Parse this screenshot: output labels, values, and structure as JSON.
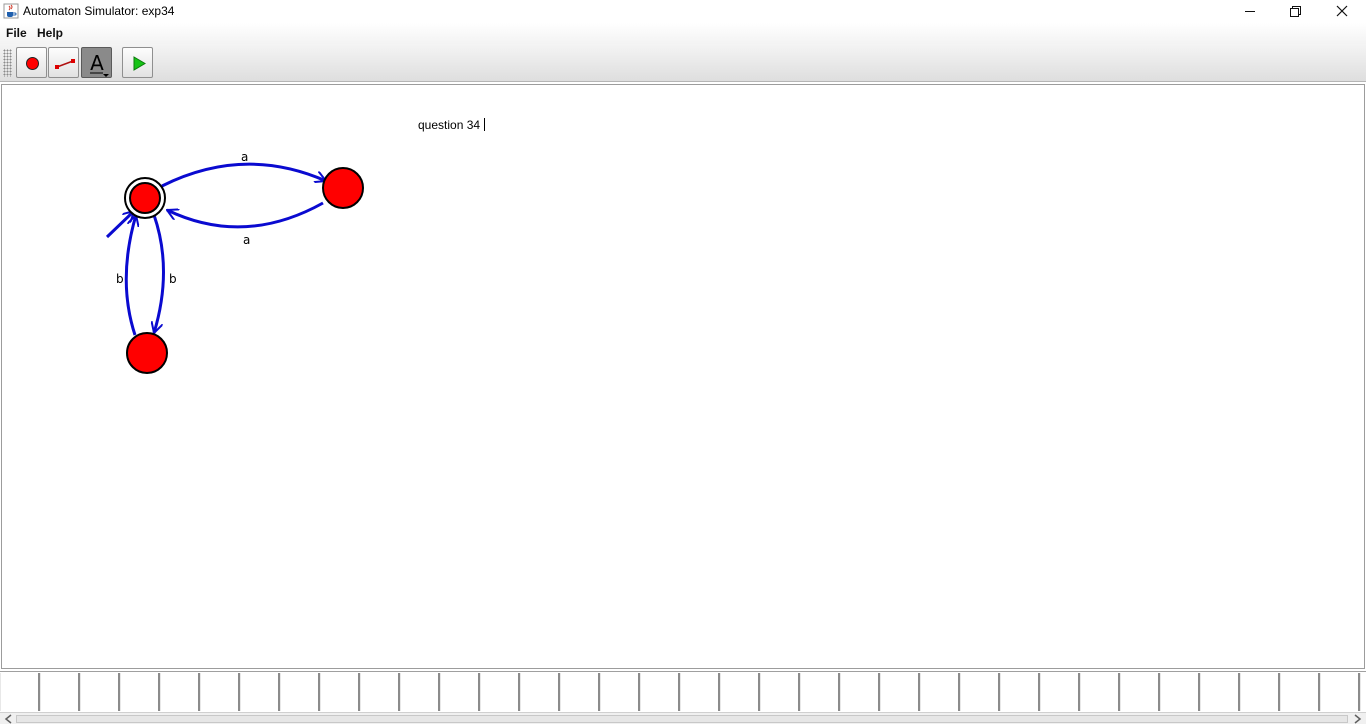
{
  "window": {
    "title": "Automaton Simulator: exp34",
    "app_icon": "java-cup-icon",
    "controls": [
      "minimize-icon",
      "restore-icon",
      "close-icon"
    ]
  },
  "menu": {
    "items": [
      "File",
      "Help"
    ]
  },
  "toolbar": {
    "tools": [
      {
        "name": "state-tool",
        "icon": "red-circle-icon"
      },
      {
        "name": "transition-tool",
        "icon": "transition-line-icon"
      },
      {
        "name": "text-tool",
        "icon": "letter-a-icon",
        "glyph": "A",
        "active": true
      },
      {
        "name": "simulate-tool",
        "icon": "play-icon"
      }
    ]
  },
  "canvas": {
    "note": "question 34",
    "colors": {
      "state_fill": "#ff0000",
      "state_stroke": "#000000",
      "transition": "#0000cc"
    },
    "states": [
      {
        "id": "q0",
        "accepting": true,
        "initial": true
      },
      {
        "id": "q1",
        "accepting": false,
        "initial": false
      },
      {
        "id": "q2",
        "accepting": false,
        "initial": false
      }
    ],
    "transitions": [
      {
        "from": "q0",
        "to": "q1",
        "label": "a"
      },
      {
        "from": "q1",
        "to": "q0",
        "label": "a"
      },
      {
        "from": "q0",
        "to": "q2",
        "label": "b"
      },
      {
        "from": "q2",
        "to": "q0",
        "label": "b"
      }
    ]
  },
  "tape": {
    "cells": [
      "",
      "",
      "",
      "",
      "",
      "",
      "",
      "",
      "",
      "",
      "",
      "",
      "",
      "",
      "",
      "",
      "",
      "",
      "",
      "",
      "",
      "",
      "",
      "",
      "",
      "",
      "",
      "",
      "",
      "",
      "",
      "",
      "",
      "",
      ""
    ]
  }
}
